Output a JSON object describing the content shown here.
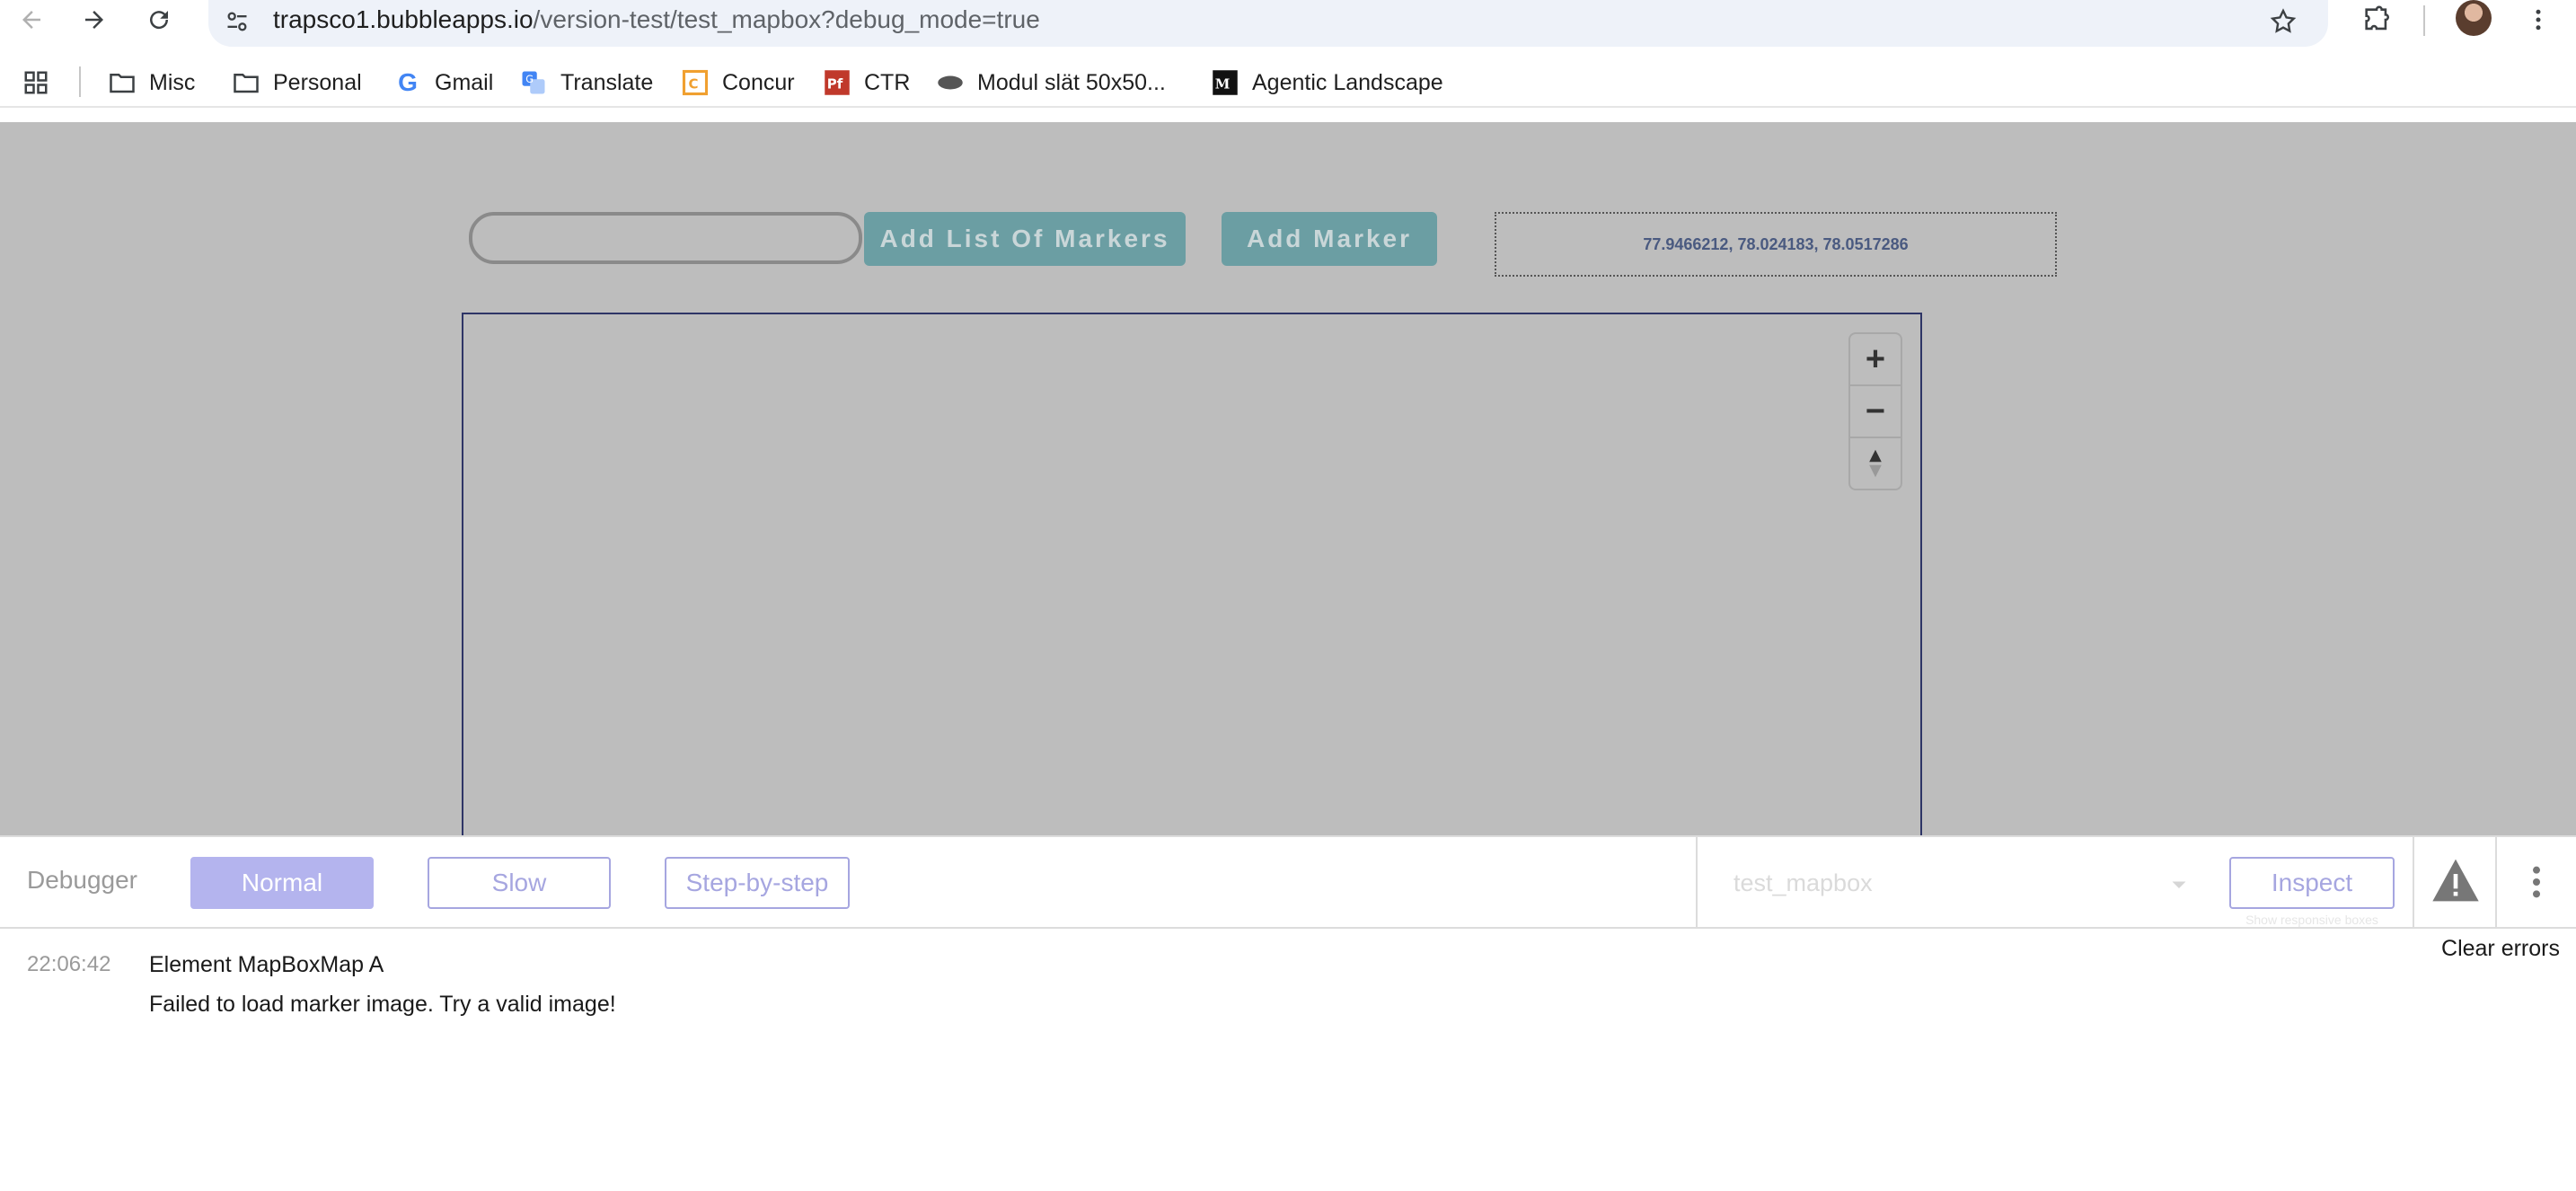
{
  "browser": {
    "url_host": "trapsco1.bubbleapps.io",
    "url_path": "/version-test/test_mapbox?debug_mode=true"
  },
  "bookmarks": [
    {
      "label": "Misc",
      "icon": "folder-icon"
    },
    {
      "label": "Personal",
      "icon": "folder-icon"
    },
    {
      "label": "Gmail",
      "icon": "google-icon"
    },
    {
      "label": "Translate",
      "icon": "translate-icon"
    },
    {
      "label": "Concur",
      "icon": "concur-icon"
    },
    {
      "label": "CTR",
      "icon": "pdf-icon"
    },
    {
      "label": "Modul slät 50x50...",
      "icon": "oval-icon"
    },
    {
      "label": "Agentic Landscape",
      "icon": "medium-icon"
    }
  ],
  "page": {
    "add_list_button": "Add List Of Markers",
    "add_marker_button": "Add Marker",
    "coordinates": "77.9466212, 78.024183, 78.0517286",
    "text_input_value": "",
    "zoom_in": "+",
    "zoom_out": "−"
  },
  "debugger": {
    "label": "Debugger",
    "mode_normal": "Normal",
    "mode_slow": "Slow",
    "mode_step": "Step-by-step",
    "page_select": "test_mapbox",
    "inspect": "Inspect",
    "responsive_label": "Show responsive boxes"
  },
  "log": {
    "clear": "Clear errors",
    "entries": [
      {
        "time": "22:06:42",
        "element": "Element MapBoxMap A",
        "message": "Failed to load marker image. Try a valid image!"
      }
    ]
  },
  "colors": {
    "teal_button": "#6b9ea3",
    "page_overlay": "#bdbdbd",
    "debugger_accent": "#b4b4ee"
  }
}
